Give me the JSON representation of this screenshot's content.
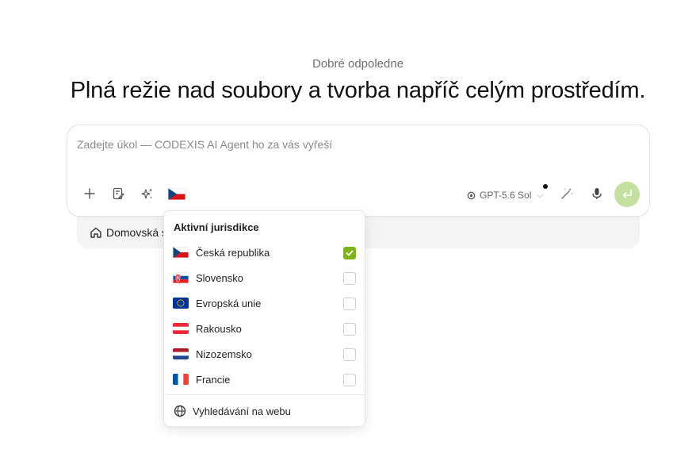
{
  "greeting": "Dobré odpoledne",
  "headline": "Plná režie nad soubory a tvorba napříč celým prostředím.",
  "composer": {
    "placeholder": "Zadejte úkol — CODEXIS AI Agent ho za vás vyřeší",
    "model_label": "GPT-5.6 Sol",
    "icons": [
      "plus-icon",
      "notebook-edit-icon",
      "sparkles-icon",
      "czech-flag-icon",
      "model-icon",
      "chevron-down-icon",
      "magic-wand-icon",
      "microphone-icon",
      "enter-icon"
    ],
    "send_color": "#c3e0a0"
  },
  "subbar": {
    "home_label": "Domovská s"
  },
  "dropdown": {
    "title": "Aktivní jurisdikce",
    "items": [
      {
        "label": "Česká republika",
        "checked": true,
        "flag": "cz"
      },
      {
        "label": "Slovensko",
        "checked": false,
        "flag": "sk"
      },
      {
        "label": "Evropská unie",
        "checked": false,
        "flag": "eu"
      },
      {
        "label": "Rakousko",
        "checked": false,
        "flag": "at"
      },
      {
        "label": "Nizozemsko",
        "checked": false,
        "flag": "nl"
      },
      {
        "label": "Francie",
        "checked": false,
        "flag": "fr"
      }
    ],
    "web_search_label": "Vyhledávání na webu",
    "check_color": "#7cb518"
  }
}
